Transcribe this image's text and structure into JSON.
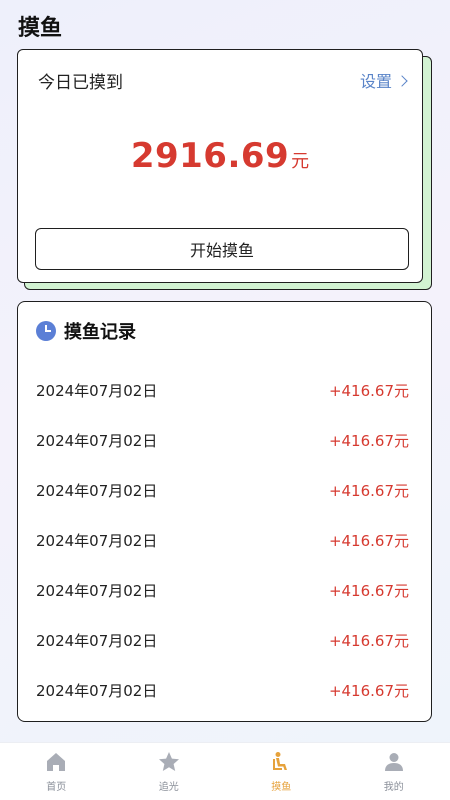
{
  "header": {
    "title": "摸鱼"
  },
  "summary": {
    "label": "今日已摸到",
    "settings_label": "设置",
    "amount": "2916.69",
    "unit": "元",
    "start_button": "开始摸鱼"
  },
  "records": {
    "title": "摸鱼记录",
    "items": [
      {
        "date": "2024年07月02日",
        "amount": "+416.67元"
      },
      {
        "date": "2024年07月02日",
        "amount": "+416.67元"
      },
      {
        "date": "2024年07月02日",
        "amount": "+416.67元"
      },
      {
        "date": "2024年07月02日",
        "amount": "+416.67元"
      },
      {
        "date": "2024年07月02日",
        "amount": "+416.67元"
      },
      {
        "date": "2024年07月02日",
        "amount": "+416.67元"
      },
      {
        "date": "2024年07月02日",
        "amount": "+416.67元"
      }
    ]
  },
  "nav": {
    "items": [
      {
        "label": "首页",
        "icon": "home-icon"
      },
      {
        "label": "追光",
        "icon": "star-icon"
      },
      {
        "label": "摸鱼",
        "icon": "seat-icon",
        "active": true
      },
      {
        "label": "我的",
        "icon": "user-icon"
      }
    ]
  },
  "colors": {
    "accent_red": "#d63a30",
    "link_blue": "#5a84c8",
    "nav_active": "#e6a23c",
    "card_shadow_green": "#d2f3d2"
  }
}
